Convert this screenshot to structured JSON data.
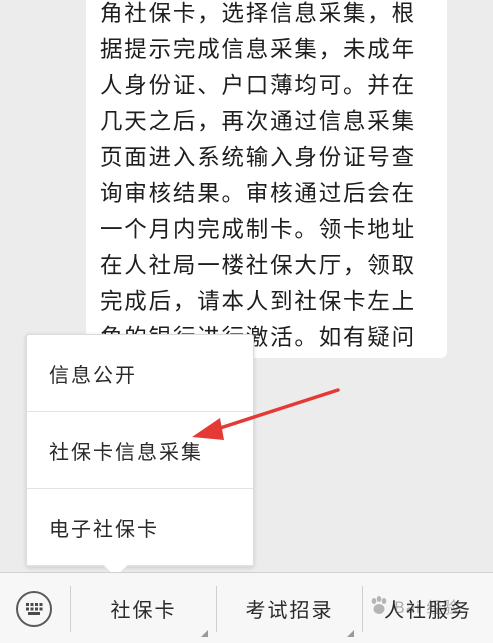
{
  "chat": {
    "message_text": "角社保卡，选择信息采集，根据提示完成信息采集，未成年人身份证、户口薄均可。并在几天之后，再次通过信息采集页面进入系统输入身份证号查询审核结果。审核通过后会在一个月内完成制卡。领卡地址在人社局一楼社保大厅，领取完成后，请本人到社保卡左上角的银行进行激活。如有疑问请点击微信公众号右下角人社服务，选择联系方式即可。"
  },
  "popup_menu": {
    "items": [
      {
        "label": "信息公开"
      },
      {
        "label": "社保卡信息采集"
      },
      {
        "label": "电子社保卡"
      }
    ]
  },
  "annotation": {
    "arrow_color": "#e53935"
  },
  "bottom_menu": {
    "keyboard_icon": "keyboard-icon",
    "items": [
      {
        "label": "社保卡"
      },
      {
        "label": "考试招录"
      },
      {
        "label": "人社服务"
      }
    ]
  },
  "watermark": {
    "text": "Bai 经验"
  }
}
